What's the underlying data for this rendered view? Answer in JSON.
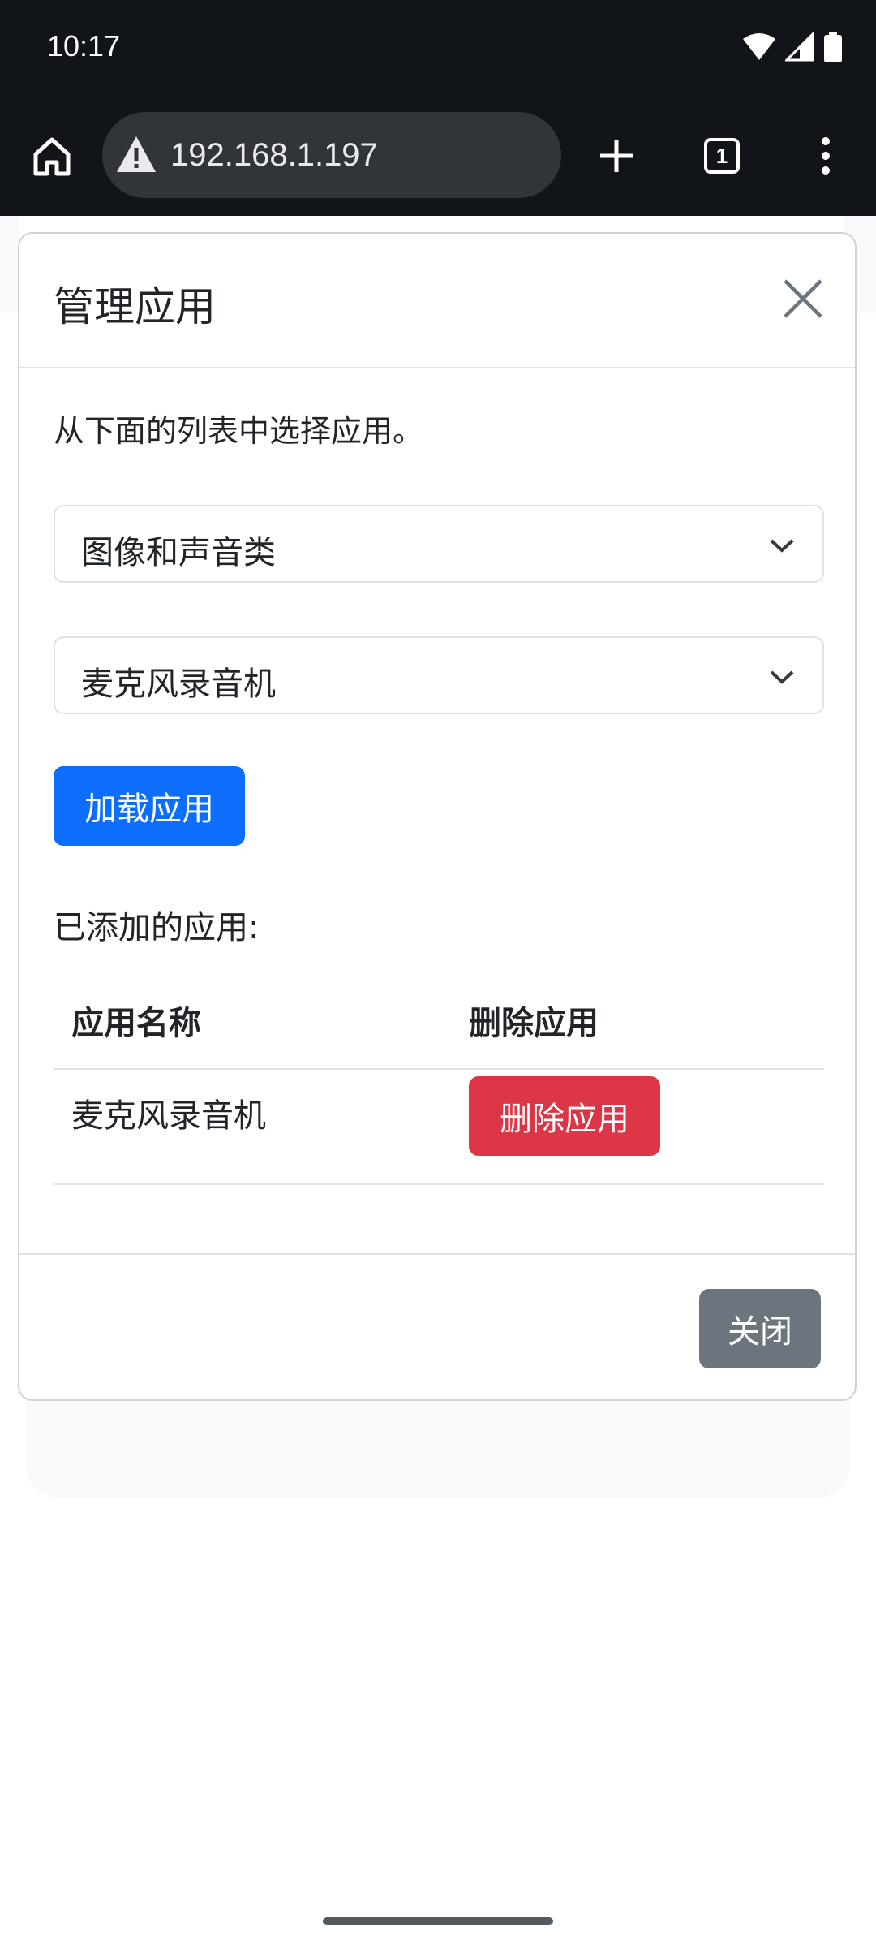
{
  "status_bar": {
    "time": "10:17"
  },
  "browser": {
    "url": "192.168.1.197",
    "tab_count": "1"
  },
  "modal": {
    "title": "管理应用",
    "intro": "从下面的列表中选择应用。",
    "category_select": {
      "value": "图像和声音类"
    },
    "app_select": {
      "value": "麦克风录音机"
    },
    "load_button": "加载应用",
    "added_label": "已添加的应用:",
    "table": {
      "headers": [
        "应用名称",
        "删除应用"
      ],
      "rows": [
        {
          "name": "麦克风录音机",
          "action": "删除应用"
        }
      ]
    },
    "close_button": "关闭"
  },
  "colors": {
    "primary": "#0d6efd",
    "danger": "#dc3545",
    "secondary": "#6c757d",
    "browser_chrome": "#111418"
  }
}
